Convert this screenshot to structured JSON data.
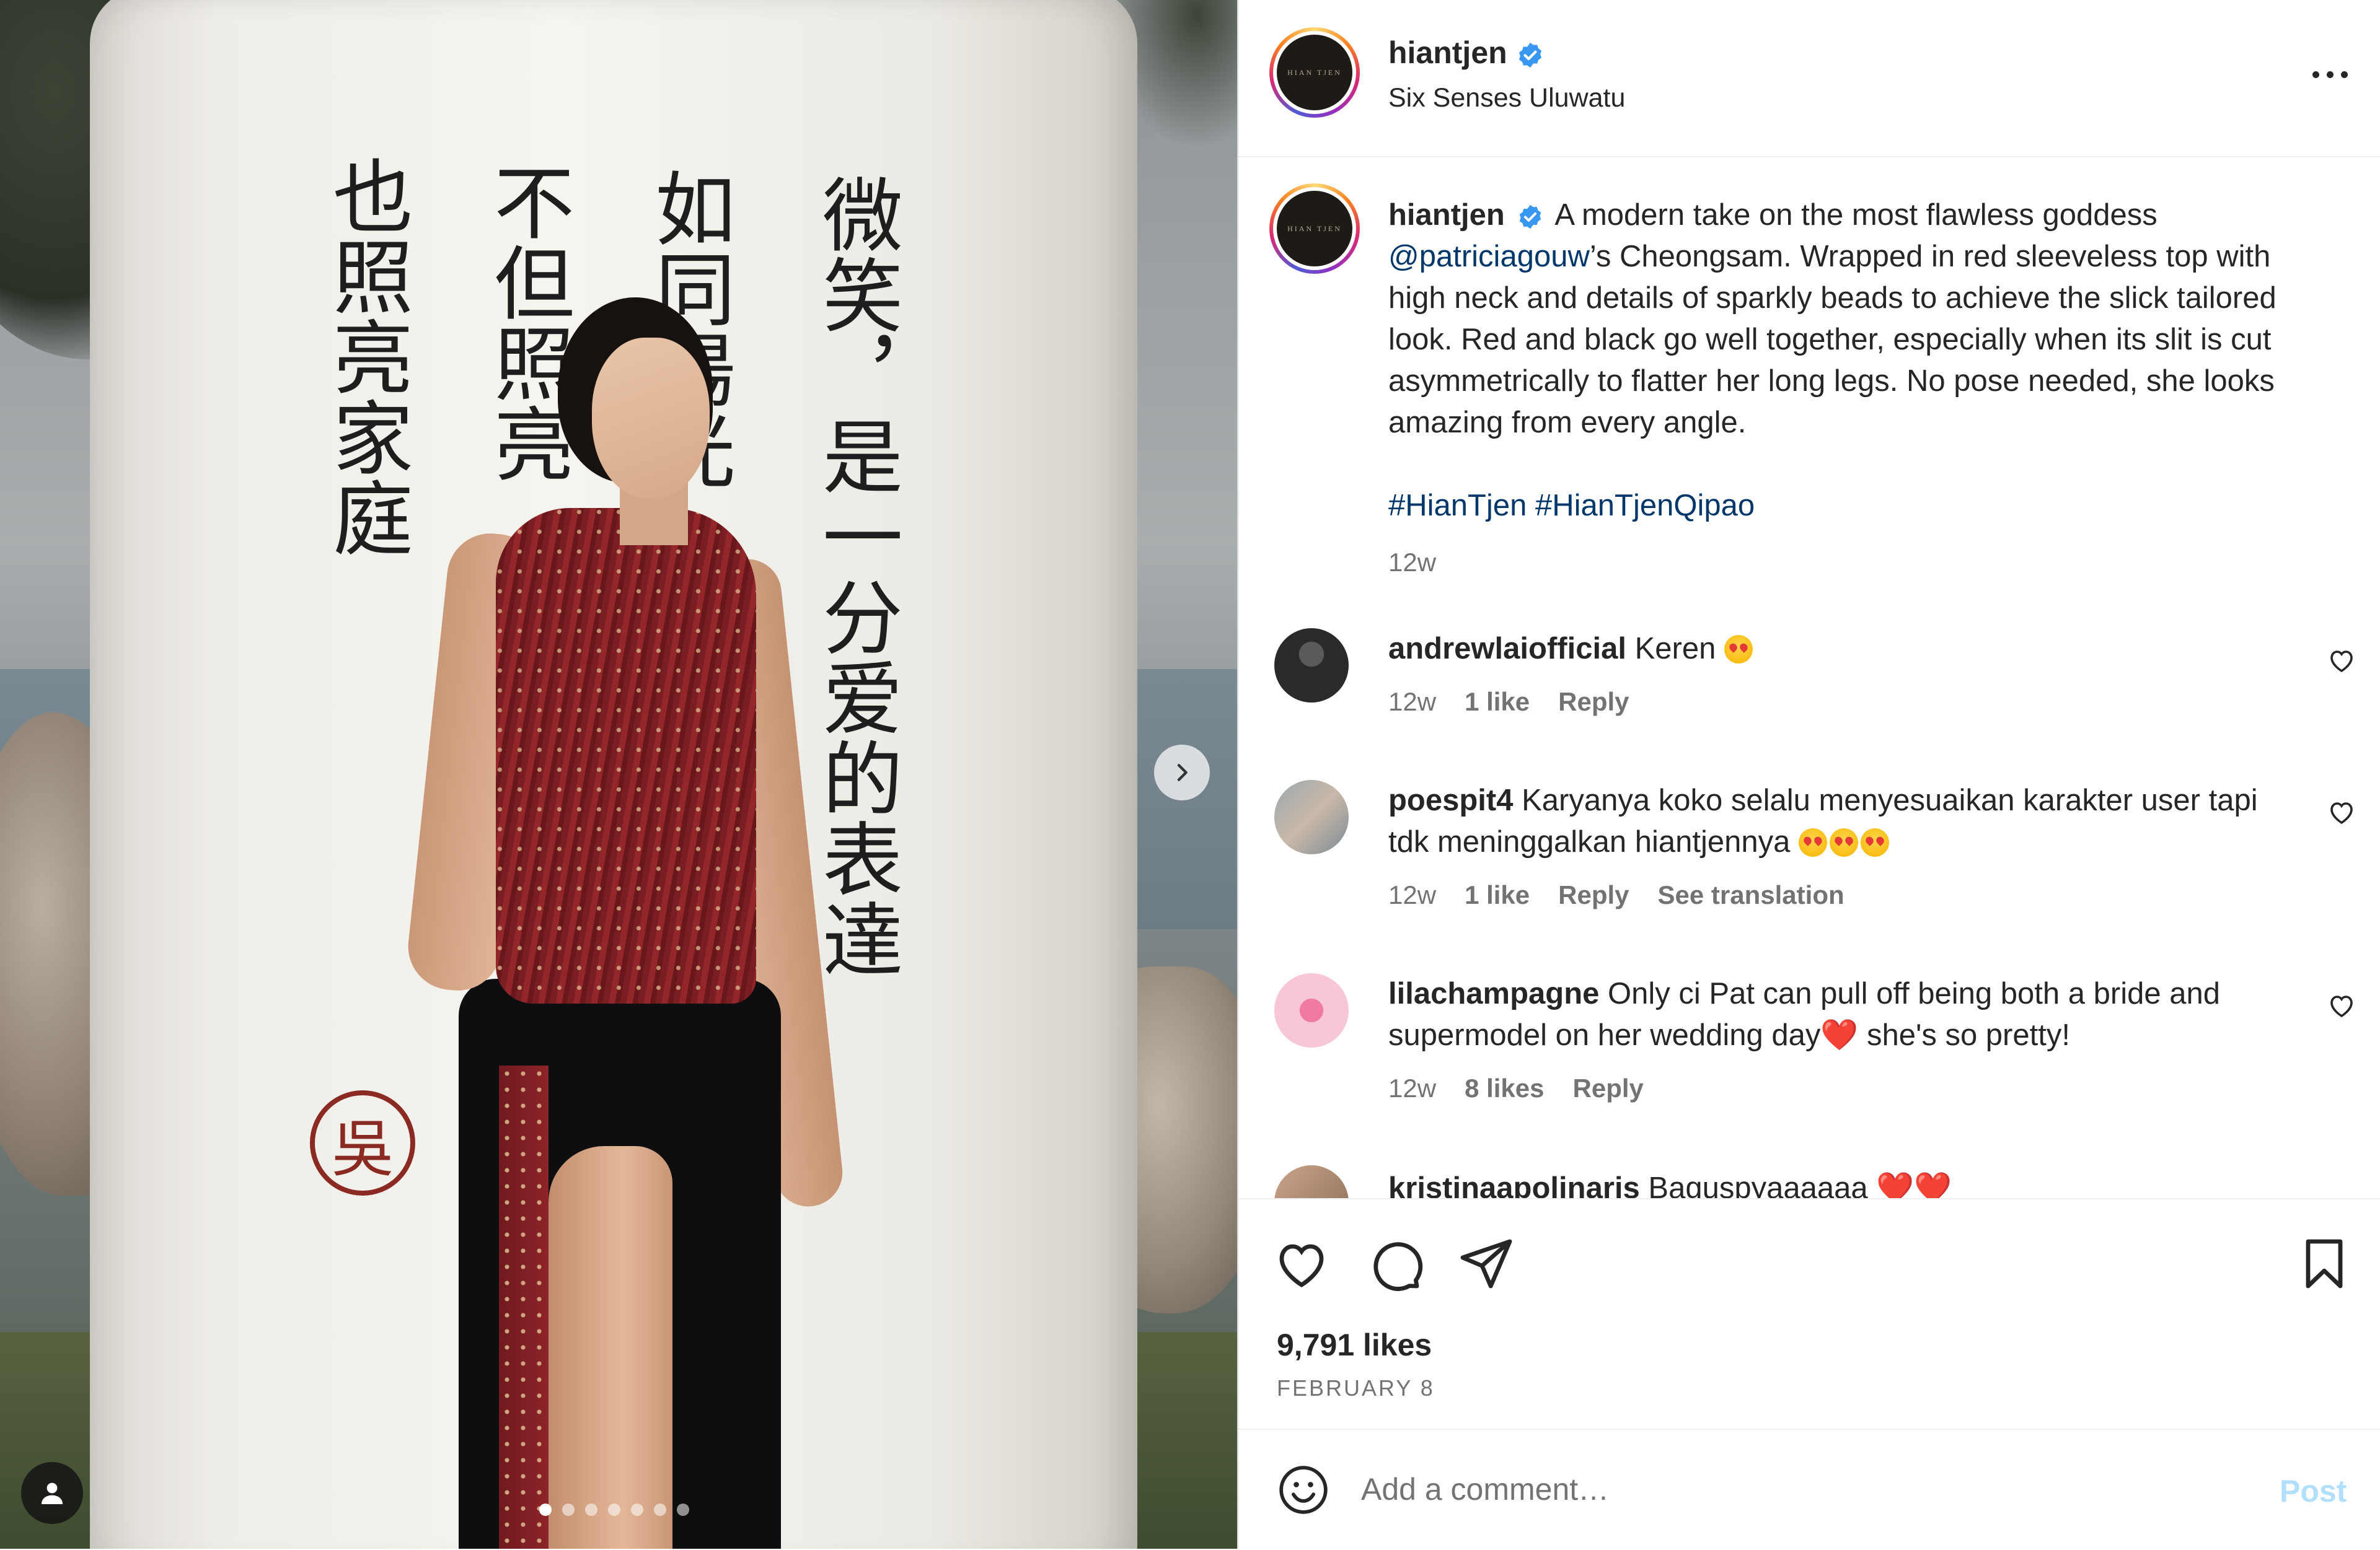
{
  "post": {
    "username": "hiantjen",
    "location": "Six Senses Uluwatu",
    "brand_mark": "HIAN TJEN",
    "verified": true
  },
  "photo": {
    "calligraphy_columns": [
      "微笑，是一分爱的表達",
      "如同陽光",
      "不但照亮",
      "也照亮家庭"
    ],
    "seal": "吳",
    "carousel": {
      "count": 7,
      "active": 0
    }
  },
  "caption": {
    "username": "hiantjen",
    "text_before_mention": "A modern take on the most flawless goddess",
    "mention": "@patriciagouw",
    "text_after_mention": "’s Cheongsam. Wrapped in red sleeveless top with high neck and details of sparkly beads to achieve the slick tailored look. Red and black go well together, especially when its slit is cut asymmetrically to flatter her long legs. No pose needed, she looks amazing from every angle.",
    "hashtags": [
      "#HianTjen",
      "#HianTjenQipao"
    ],
    "time": "12w"
  },
  "comments": [
    {
      "username": "andrewlaiofficial",
      "text": "Keren",
      "emoji_count": 1,
      "time": "12w",
      "likes": "1 like",
      "reply": "Reply",
      "translate": ""
    },
    {
      "username": "poespit4",
      "text": "Karyanya koko selalu menyesuaikan karakter user tapi tdk meninggalkan hiantjennya",
      "emoji_count": 3,
      "time": "12w",
      "likes": "1 like",
      "reply": "Reply",
      "translate": "See translation"
    },
    {
      "username": "lilachampagne",
      "text_a": "Only ci Pat can pull off being both a bride and supermodel on her wedding day",
      "heart": "❤️",
      "text_b": " she's so pretty!",
      "time": "12w",
      "likes": "8 likes",
      "reply": "Reply"
    },
    {
      "username": "kristinaapolinaris",
      "text": "Baguspyaaaaaa",
      "heart": "❤️❤️"
    }
  ],
  "actions": {
    "likes": "9,791 likes",
    "date": "FEBRUARY 8"
  },
  "composer": {
    "placeholder": "Add a comment…",
    "post_label": "Post"
  },
  "colors": {
    "link": "#00376b",
    "muted": "#737373",
    "post_disabled": "#b2dffc",
    "verified": "#3897f0"
  }
}
